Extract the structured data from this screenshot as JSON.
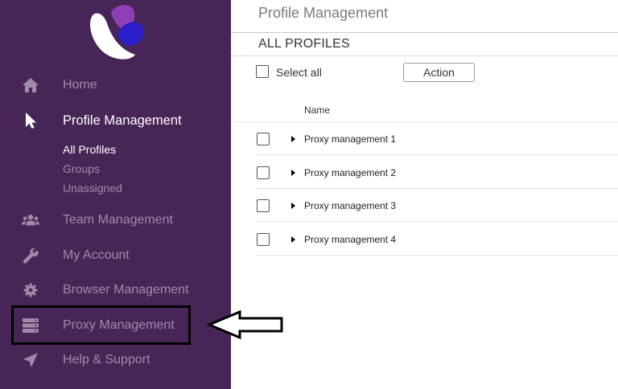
{
  "colors": {
    "sidebar_bg": "#482557",
    "sidebar_text": "#9f8aa8",
    "sidebar_active": "#ffffff",
    "logo_light": "#ffffff",
    "logo_purple": "#8e3fb5",
    "logo_blue": "#2a1ec8"
  },
  "sidebar": {
    "items": [
      {
        "label": "Home",
        "icon": "home-icon"
      },
      {
        "label": "Profile Management",
        "icon": "cursor-icon",
        "active": true
      },
      {
        "label": "Team Management",
        "icon": "users-icon"
      },
      {
        "label": "My Account",
        "icon": "wrench-icon"
      },
      {
        "label": "Browser Management",
        "icon": "gear-icon"
      },
      {
        "label": "Proxy Management",
        "icon": "server-icon"
      },
      {
        "label": "Help & Support",
        "icon": "paper-plane-icon"
      }
    ],
    "sub_items": [
      {
        "label": "All Profiles",
        "active": true
      },
      {
        "label": "Groups"
      },
      {
        "label": "Unassigned"
      }
    ]
  },
  "main": {
    "page_title": "Profile Management",
    "section_title": "ALL PROFILES",
    "select_all_label": "Select all",
    "action_label": "Action",
    "table": {
      "column_header": "Name",
      "rows": [
        {
          "name": "Proxy management 1"
        },
        {
          "name": "Proxy management 2"
        },
        {
          "name": "Proxy management 3"
        },
        {
          "name": "Proxy management 4"
        }
      ]
    }
  }
}
